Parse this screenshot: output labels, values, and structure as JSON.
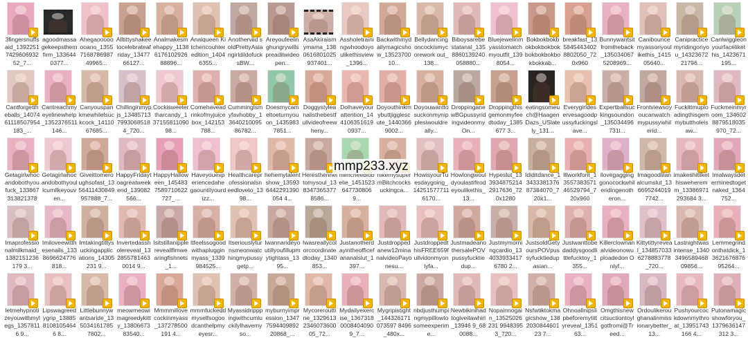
{
  "watermark": "mmp233.xyz",
  "colors": {
    "badge": "#f2b400",
    "label_text": "#333333",
    "background": "#ffffff"
  },
  "items": [
    {
      "label": "3fingersnuffsaid_1392251742960693252_7...",
      "color": "#e8a8c0",
      "type": "video"
    },
    {
      "label": "agoodmassagekeepsthemfirm_1336440377...",
      "color": "#2a2a2a",
      "type": "film"
    },
    {
      "label": "Ahegaoooooooano_1355716878698749965...",
      "color": "#f0c0c8",
      "type": "video"
    },
    {
      "label": "Alltittyshakeetocelebrateafriday_1347766127...",
      "color": "#c8a090",
      "type": "video"
    },
    {
      "label": "Analmakesmehappy_1138617610292688896...",
      "color": "#d8b0a0",
      "type": "video"
    },
    {
      "label": "Analqueen Kitchencouhteredition_14046355...",
      "color": "#e0c0b0",
      "type": "video"
    },
    {
      "label": "Anotherviid soldPrettyAsiangirldildofucksBW...",
      "color": "#c0a8a0",
      "type": "video"
    },
    {
      "label": "Areyoufeelinghungrywillspreaditwideopen...",
      "color": "#b89890",
      "type": "video"
    },
    {
      "label": "AsaAkiraismymama_1380616801025937401...",
      "color": "#ccb0a8",
      "type": "film"
    },
    {
      "label": "Assholetrainingwhoodoyoulikethisview_1396...",
      "color": "#e8c8c0",
      "type": "video"
    },
    {
      "label": "Backwithmydailymagicshow_1352370010...",
      "color": "#d0a898",
      "type": "video"
    },
    {
      "label": "Bellydancingoncockismycorework out_138...",
      "color": "#d8b8a8",
      "type": "video"
    },
    {
      "label": "Biboysarebestatanal_1358860139240058880...",
      "color": "#e0b8b8",
      "type": "video"
    },
    {
      "label": "Bluejewelinmyasstomatchmyoutfit_1398054...",
      "color": "#f0c0d0",
      "type": "video"
    },
    {
      "label": "Bokbokbokbokbokbokbokbokbokbokbokbokkab...",
      "color": "#c89888",
      "type": "video"
    },
    {
      "label": "breakfast_1358454434028802050_720x960",
      "color": "#d8a090",
      "type": "video"
    },
    {
      "label": "Bunnywantsitfromtheback_1350340675208969...",
      "color": "#e8b0c0",
      "type": "video"
    },
    {
      "label": "Canibouncemyassonyoulikethis_141505640...",
      "color": "#e0c0b8",
      "type": "video"
    },
    {
      "label": "Canipracticemyridingonyou_1432367221796...",
      "color": "#c8b8a8",
      "type": "video"
    },
    {
      "label": "Canlwiggleonyourfacelikethis_1423671195...",
      "color": "#b8d0b8",
      "type": "video"
    },
    {
      "label": "Cantforgettheballs_1407461118507954183_...",
      "color": "#e0c8c0",
      "type": "video"
    },
    {
      "label": "Cantreachmyeyelinewhelp_1352376511146...",
      "color": "#e8b0c0",
      "type": "video"
    },
    {
      "label": "Canyouspankmewhilelsuckcock_1411067685...",
      "color": "#d8b8a8",
      "type": "video"
    },
    {
      "label": "Chillinginmypjs_1348571379930685184_720...",
      "color": "#d8c0c8",
      "type": "video"
    },
    {
      "label": "Cockisweetertharcandy_13715581109098...",
      "color": "#f0c8d0",
      "type": "video"
    },
    {
      "label": "Comehaveadrinkofmyjuicebox_142153788...",
      "color": "#e0b0b0",
      "type": "video"
    },
    {
      "label": "Cumminglsmyfavhobby_1364021009586782...",
      "color": "#c8a8a0",
      "type": "video"
    },
    {
      "label": "Doesmycameltoeturnyouon_14359837851...",
      "color": "#90c8a8",
      "type": "video"
    },
    {
      "label": "Doggystyleanalisthebestfullvideofreewheny...",
      "color": "#d8a898",
      "type": "video"
    },
    {
      "label": "Dolhaveyourattention_1441063516190937...",
      "color": "#e8b8b0",
      "type": "video"
    },
    {
      "label": "Doyouthinkmybuttjigglescute_14403669002...",
      "color": "#e0b0a8",
      "type": "video"
    },
    {
      "label": "Doyouwanttosuckonmynipplesiwouldreally...",
      "color": "#d8b0a0",
      "type": "video"
    },
    {
      "label": "DroppinganewBGpussyridingvideonmyOn...",
      "color": "#b8a8a0",
      "type": "video"
    },
    {
      "label": "Droppingthisgemonmyfeedtoday_1385677 3...",
      "color": "#c8a090",
      "type": "video"
    },
    {
      "label": "eatingsomeuch@HaagenDazs_USlately_131...",
      "color": "#2a2420",
      "type": "video"
    },
    {
      "label": "Everygirldeservesagoodpussyfuckingslave...",
      "color": "#e8c0b0",
      "type": "video"
    },
    {
      "label": "Expertballsuckingsoundon_135034496731l...",
      "color": "#c8b0a8",
      "type": "video"
    },
    {
      "label": "Frontviewsoyoucanwatchmypussywhilerid...",
      "color": "#c0a8a0",
      "type": "video"
    },
    {
      "label": "Fuckittmuploadingthisgemmybuttholeisaw...",
      "color": "#d8b8b0",
      "type": "video"
    },
    {
      "label": "Fuckmeinmyroom_1346028879518035970_72...",
      "color": "#e0b8c0",
      "type": "video"
    },
    {
      "label": "Getagirlwhocandobothyoufuck_1338673138213781...",
      "color": "#e8b0c0",
      "type": "video"
    },
    {
      "label": "Getagirlwhocandobothyoullcumllkeyouven...",
      "color": "#f0c8d0",
      "type": "video"
    },
    {
      "label": "Giveittomeroughsofast_1356411430849957888_7...",
      "color": "#d0a898",
      "type": "video"
    },
    {
      "label": "HappyFridaytoagreatweekend_139082566...",
      "color": "#e0b8c0",
      "type": "video"
    },
    {
      "label": "HappyHalloween_1454837589710622727_...",
      "color": "#e8a0b8",
      "type": "video"
    },
    {
      "label": "Haveyouexperiencedahegaountilyourdizz...",
      "color": "#f0c0d0",
      "type": "video"
    },
    {
      "label": "Healthcareprofessionalsneedloveto_1398...",
      "color": "#f0c8c8",
      "type": "video"
    },
    {
      "label": "hehemytalentshow_135936442291390054 4...",
      "color": "#e0b8a8",
      "type": "video"
    },
    {
      "label": "Heresthenneltomysoul_1383473653778586...",
      "color": "#c8a8a0",
      "type": "video"
    },
    {
      "label": "hiimcheebiobelie_1451523647730806 9...",
      "color": "#a8d8b0",
      "type": "video"
    },
    {
      "label": "hikemysupermBitchcocksuckingca...",
      "color": "#d8b0a0",
      "type": "video"
    },
    {
      "label": "HowisyourTuesdaygoing_142515777116170...",
      "color": "#e0c0c0",
      "type": "video"
    },
    {
      "label": "Howlongwouldyoulastifirodeyoulikethis_13...",
      "color": "#e8b0b8",
      "type": "video"
    },
    {
      "label": "Hypeslut_1339348752142917636_720x1280",
      "color": "#e0a8b0",
      "type": "video"
    },
    {
      "label": "Ididitdance_1343338137687384070_720x1...",
      "color": "#c8b0a0",
      "type": "video"
    },
    {
      "label": "Illworkforit_1355738357146529794_720x960",
      "color": "#e8b0b0",
      "type": "video"
    },
    {
      "label": "llovegagginggonocockwhileridingenotheron...",
      "color": "#e0b0c8",
      "type": "video"
    },
    {
      "label": "Imagoodlilanalcumslut_1366952440197742...",
      "color": "#d0b8a8",
      "type": "video"
    },
    {
      "label": "imakeshitlikethisweheremm_13386971293684 3...",
      "color": "#e8b8c0",
      "type": "video"
    },
    {
      "label": "Imalwaysdeterminedtogetnaked_1364752...",
      "color": "#e0a8b8",
      "type": "video"
    },
    {
      "label": "Imaprofessionalmilkmaid_1382151236179 3...",
      "color": "#d8c0c0",
      "type": "video"
    },
    {
      "label": "Imiloveewitthesenails_1338696624776818...",
      "color": "#e8b8c8",
      "type": "video"
    },
    {
      "label": "Imtakingtittysuckingapplications_14305231 9...",
      "color": "#d0b0a0",
      "type": "video"
    },
    {
      "label": "Invertedassholereveal_1328557814630014 9...",
      "color": "#e0b8b0",
      "type": "video"
    },
    {
      "label": "Isitstillanipplereveallfimwearingfishnets_1...",
      "color": "#c8a8a8",
      "type": "video"
    },
    {
      "label": "Itfeelssogoodwithaplugginmyass_1339984525...",
      "color": "#d8b0a8",
      "type": "video"
    },
    {
      "label": "Itseriouslyturnsmeonwatchingmypussygetp...",
      "color": "#e0c0b0",
      "type": "video"
    },
    {
      "label": "Iwannarideyoutillyoufillupmytightass_1395...",
      "color": "#c8a8a0",
      "type": "video"
    },
    {
      "label": "Iwasreallycolorcoordinatedtoday_1340853...",
      "color": "#b8a898",
      "type": "video"
    },
    {
      "label": "Justanotherdayintheofficefananalslut_1397...",
      "color": "#d8b0a0",
      "type": "video"
    },
    {
      "label": "Justdroppedanew12minanalvideoPayonesu...",
      "color": "#e0b8b8",
      "type": "video"
    },
    {
      "label": "JustdroppedthisFREE659fullvidonmyonlyfa...",
      "color": "#e8c0c0",
      "type": "video"
    },
    {
      "label": "JustmadeanothersalePOVpussyfucktiedup...",
      "color": "#d0a8a0",
      "type": "video"
    },
    {
      "label": "Justmymorningcardio_1340339334176780 2...",
      "color": "#c8b0a8",
      "type": "video"
    },
    {
      "label": "JustsoldGetyoursPOVpussyfucktiedupasian...",
      "color": "#d8b8a8",
      "type": "video"
    },
    {
      "label": "Justwanttobedaddysgoodlittlefucktoy_1355...",
      "color": "#e0b0b0",
      "type": "video"
    },
    {
      "label": "Killerclownanalvideonowuploadedon Onlyf...",
      "color": "#e8b0c0",
      "type": "video"
    },
    {
      "label": "Kittytittyreveal_1348570336278883778_720...",
      "color": "#e0c0c8",
      "type": "video"
    },
    {
      "label": "Lastnightwasintense_1340349658946809856...",
      "color": "#d8b8b0",
      "type": "video"
    },
    {
      "label": "Lemmegrindonthatdick_1362167687695264...",
      "color": "#e8b0b8",
      "type": "video"
    },
    {
      "label": "letmehypnotizeyouwithmylegs_13578116 9...",
      "color": "#e0b8c0",
      "type": "video"
    },
    {
      "label": "Lipswagreedygrip_1388581081054646 8...",
      "color": "#e8c0c0",
      "type": "video"
    },
    {
      "label": "Littlebunnywantsaride_1350341617857802...",
      "color": "#d8b8a8",
      "type": "video"
    },
    {
      "label": "meowmeowimagreedykitty_1380667383540...",
      "color": "#e8b0c0",
      "type": "video"
    },
    {
      "label": "Mmmmillovecockinmyass_137278500191 4...",
      "color": "#d8a898",
      "type": "video"
    },
    {
      "label": "mmmfuckeddmyselfsogoodcanthelpmyeyesr...",
      "color": "#e0c0b0",
      "type": "video"
    },
    {
      "label": "Myassidripppingwithcumluckilylhavemyso...",
      "color": "#d0b0a8",
      "type": "video"
    },
    {
      "label": "myburnyimpression_1347759440989220868_...",
      "color": "#c8a898",
      "type": "video"
    },
    {
      "label": "Mycorerouttine_1329613234607360005_72...",
      "color": "#e0b8a8",
      "type": "video"
    },
    {
      "label": "Mydailyexercise_13673180008404090 9_7...",
      "color": "#e8b0b8",
      "type": "video"
    },
    {
      "label": "Mygripistight_144326171073597 8496_480x...",
      "color": "#d8b8b0",
      "type": "video"
    },
    {
      "label": "nbdjusthumpingmypillowtosomeexperime...",
      "color": "#c8a8a0",
      "type": "video"
    },
    {
      "label": "Newbikinihadtogiveitawhirl_13946 9_680088...",
      "color": "#e0b8b8",
      "type": "video"
    },
    {
      "label": "Nopainnogain_13525026231 99483953_720...",
      "color": "#e8c0c0",
      "type": "video"
    },
    {
      "label": "Nsfwtiktokmagicshow_138203084460123 7...",
      "color": "#d0b0a8",
      "type": "video"
    },
    {
      "label": "Ohnoallnipslipbeforemytittyreveal_135163...",
      "color": "#e8b0c0",
      "type": "video"
    },
    {
      "label": "Omgthisnewcitsuctiontoylgotfromi@Treed...",
      "color": "#e0a8b8",
      "type": "video"
    },
    {
      "label": "Ordoulikeroughanalinmissionarybetter_13...",
      "color": "#d8b8c0",
      "type": "video"
    },
    {
      "label": "Pushyourcockdownmythroat_13951743166 4...",
      "color": "#e8b8c0",
      "type": "video"
    },
    {
      "label": "Putonamagicshowforyou_1379636147312 3...",
      "color": "#e0b0b8",
      "type": "video"
    }
  ]
}
